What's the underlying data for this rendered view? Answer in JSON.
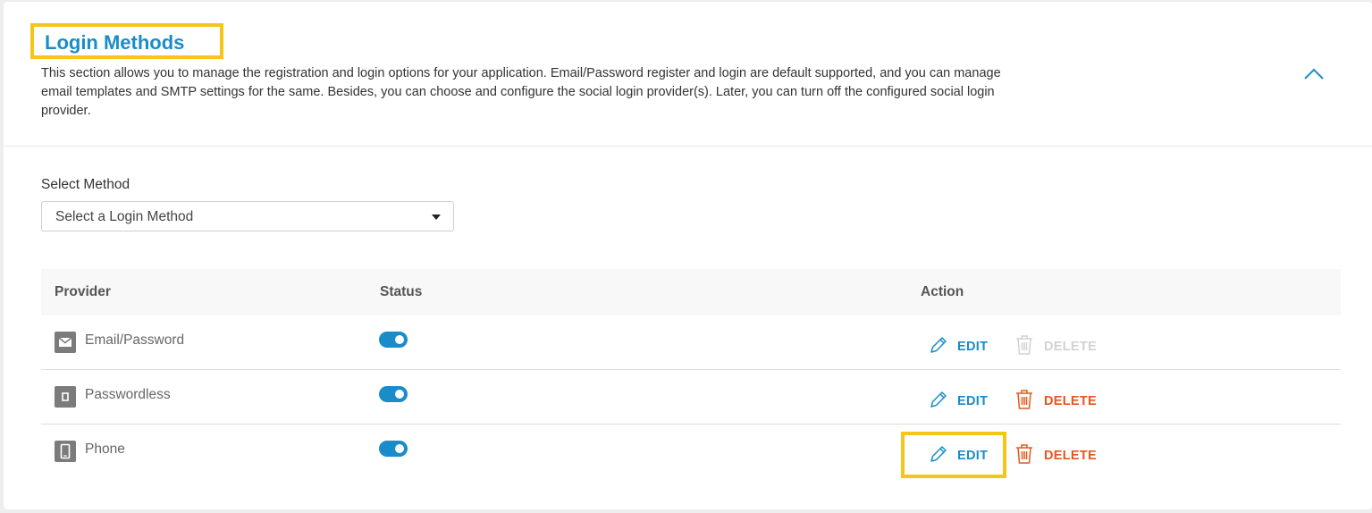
{
  "section": {
    "title": "Login Methods",
    "description": "This section allows you to manage the registration and login options for your application. Email/Password register and login are default supported, and you can manage email templates and SMTP settings for the same. Besides, you can choose and configure the social login provider(s). Later, you can turn off the configured social login provider."
  },
  "select": {
    "label": "Select Method",
    "placeholder": "Select a Login Method"
  },
  "table": {
    "headers": {
      "provider": "Provider",
      "status": "Status",
      "action": "Action"
    },
    "rows": [
      {
        "provider": "Email/Password",
        "icon": "envelope-icon",
        "enabled": true,
        "edit": "EDIT",
        "delete": "DELETE",
        "delete_enabled": false
      },
      {
        "provider": "Passwordless",
        "icon": "device-icon",
        "enabled": true,
        "edit": "EDIT",
        "delete": "DELETE",
        "delete_enabled": true
      },
      {
        "provider": "Phone",
        "icon": "phone-icon",
        "enabled": true,
        "edit": "EDIT",
        "delete": "DELETE",
        "delete_enabled": true
      }
    ]
  },
  "colors": {
    "accent": "#1a8cc8",
    "delete": "#e8561f",
    "disabled": "#d2d2d2",
    "highlight": "#f5c518"
  }
}
